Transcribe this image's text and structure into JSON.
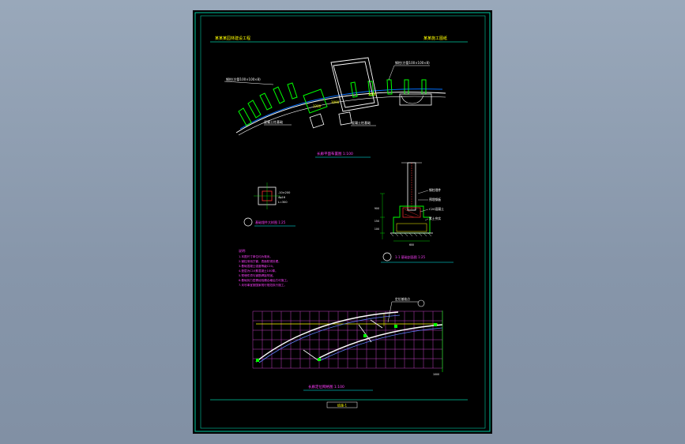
{
  "drawing": {
    "header_left": "某某某园林建设工程",
    "header_right": "某某施工图纸",
    "plan_title": "长廊平面布置图 1:100",
    "section_title": "1-1 基础剖面图 1:25",
    "detail_title": "基础埋件大样图 1:25",
    "grid_title": "长廊定位网格图 1:100",
    "footer_label": "结施-1",
    "plan_callout_left": "钢柱(方管100×100×8)",
    "plan_callout_right": "钢柱(方管100×100×8)",
    "plan_callout_bottom": "混凝土柱基础",
    "plan_callout_bottom2": "混凝土柱基础",
    "dim_a": "1200",
    "dim_b": "3000",
    "dim_c": "3000",
    "section_labels": [
      "钢柱埋件",
      "预埋钢板",
      "C20混凝土",
      "素土夯实"
    ],
    "detail_dims": [
      "-10×200",
      "4φ16",
      "L=300"
    ],
    "section_dims": [
      "900",
      "150",
      "100",
      "600"
    ],
    "notes": [
      "说明:",
      "1.本图尺寸单位均为毫米。",
      "2.钢柱采用方管，表面防锈处理。",
      "3.基础混凝土强度等级C20。",
      "4.垫层为C10素混凝土100厚。",
      "5.预埋件须与钢筋焊接牢固。",
      "6.基础持力层需经验槽合格后方可施工。",
      "7.未尽事宜按国家现行规范执行施工。"
    ],
    "grid_callout": "定位基准点"
  },
  "colors": {
    "frame": "#00c8a0",
    "accent_yellow": "#ffff00",
    "accent_green": "#00ff00",
    "accent_magenta": "#ff40ff",
    "line_white": "#ffffff",
    "grid_magenta": "#c040c0",
    "hatch_red": "#ff3030",
    "dim_cyan": "#00ffff"
  }
}
